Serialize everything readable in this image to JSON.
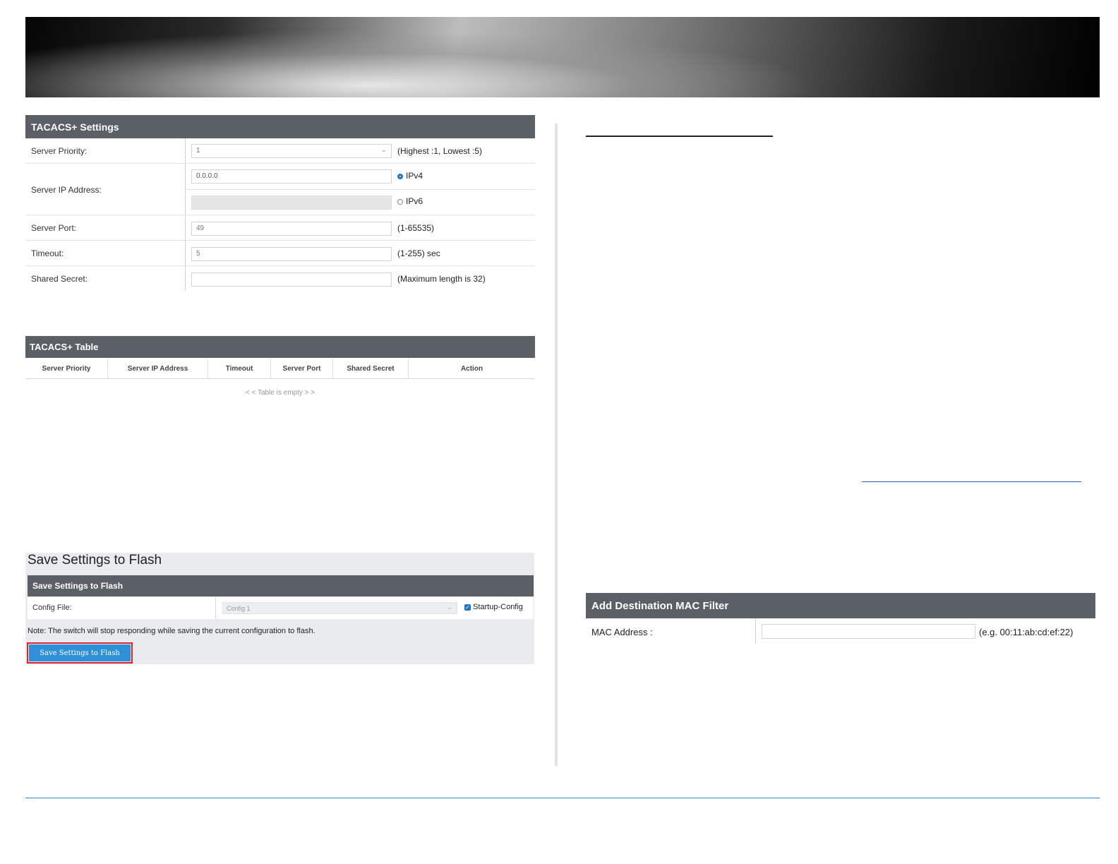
{
  "tacacs_settings": {
    "header": "TACACS+ Settings",
    "priority_label": "Server Priority:",
    "priority_value": "1",
    "priority_hint": "(Highest :1, Lowest :5)",
    "ip_label": "Server IP Address:",
    "ipv4_value": "0.0.0.0",
    "ipv4_label": "IPv4",
    "ipv6_label": "IPv6",
    "port_label": "Server Port:",
    "port_value": "49",
    "port_hint": "(1-65535)",
    "timeout_label": "Timeout:",
    "timeout_value": "5",
    "timeout_hint": "(1-255) sec",
    "secret_label": "Shared Secret:",
    "secret_value": "",
    "secret_hint": "(Maximum length is 32)"
  },
  "tacacs_table": {
    "header": "TACACS+ Table",
    "columns": [
      "Server Priority",
      "Server IP Address",
      "Timeout",
      "Server Port",
      "Shared Secret",
      "Action"
    ],
    "empty_text": "< < Table is empty > >"
  },
  "save_flash": {
    "title": "Save Settings to Flash",
    "header": "Save Settings to Flash",
    "config_label": "Config File:",
    "config_value": "Config 1",
    "startup_label": "Startup-Config",
    "startup_checked": true,
    "note": "Note: The switch will stop responding while saving the current configuration to flash.",
    "button": "Save Settings to Flash"
  },
  "mac_filter": {
    "header": "Add Destination MAC Filter",
    "mac_label": "MAC Address :",
    "mac_value": "",
    "mac_hint": "(e.g. 00:11:ab:cd:ef:22)"
  },
  "colors": {
    "panel_header": "#5b5f66",
    "accent_button": "#2f8fd8",
    "highlight_border": "#d9232e",
    "footer_line": "#3a83c9"
  }
}
